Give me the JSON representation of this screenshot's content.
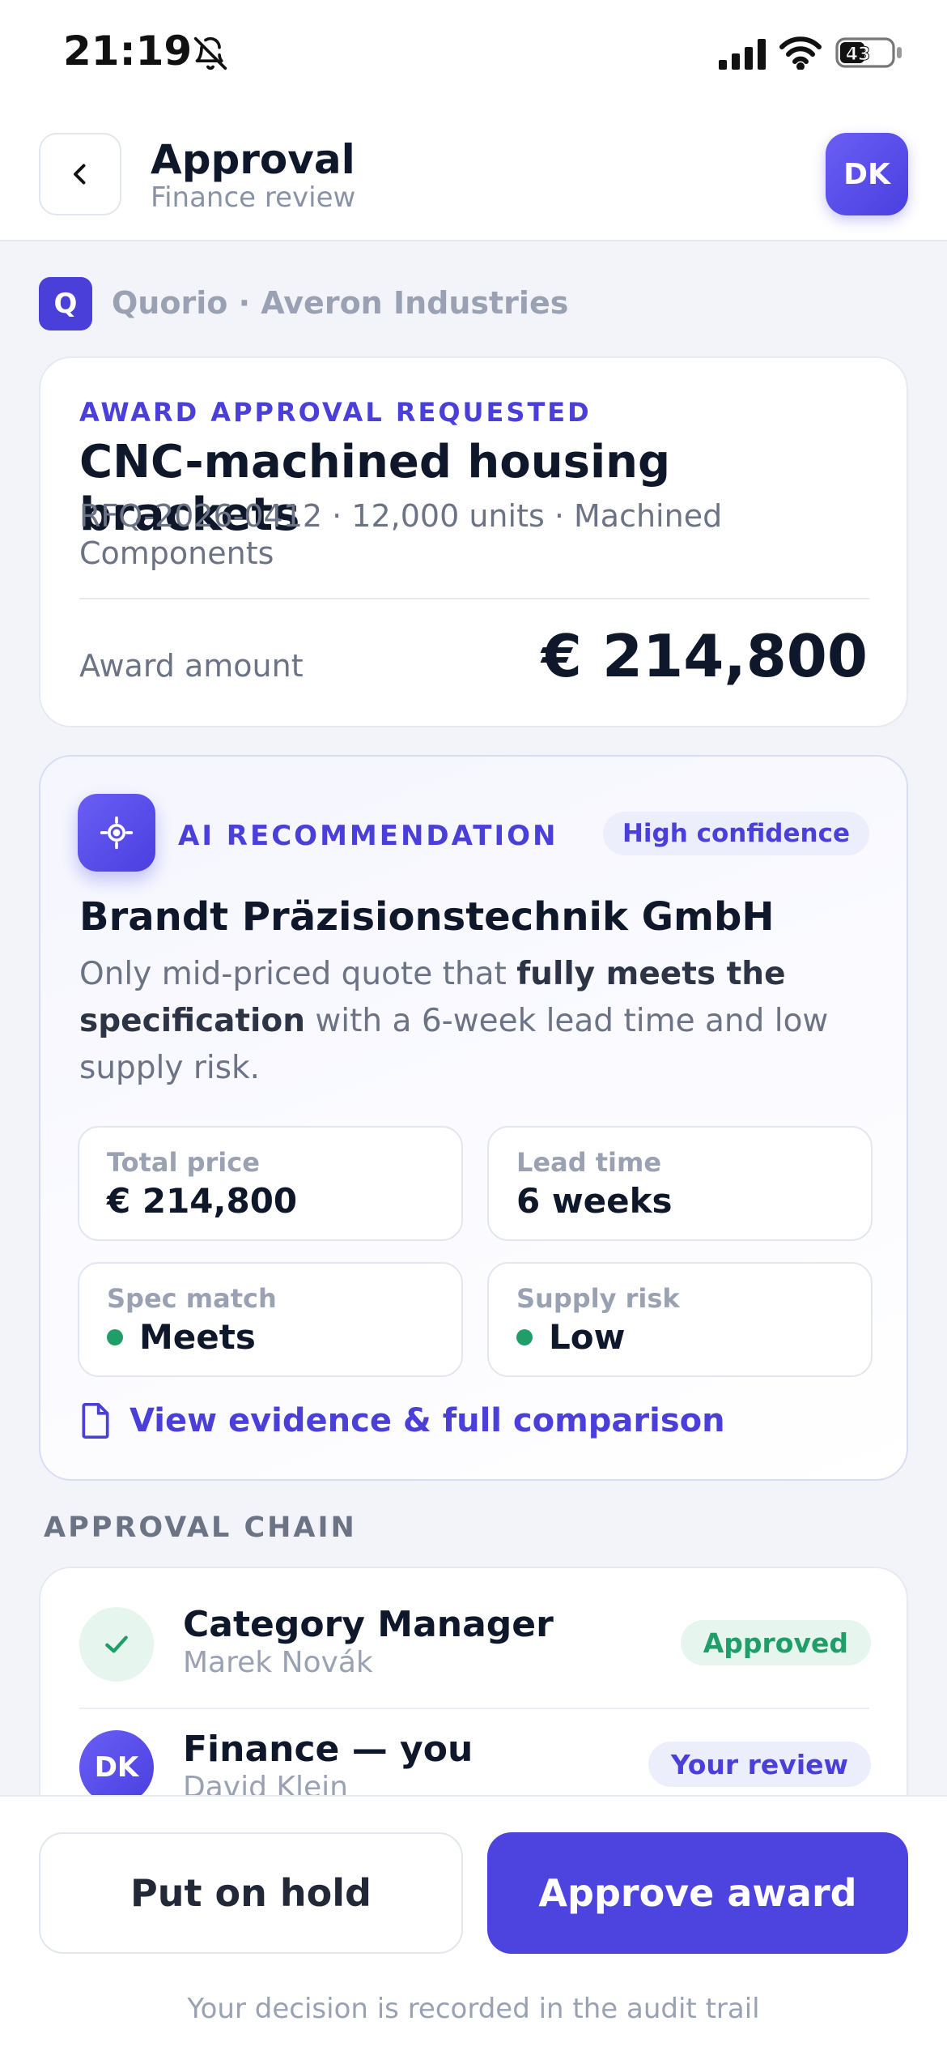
{
  "status_bar": {
    "time": "21:19",
    "battery_level": "43",
    "icons": [
      "bell-slash-icon",
      "signal-icon",
      "wifi-icon",
      "battery-icon"
    ]
  },
  "header": {
    "title": "Approval",
    "subtitle": "Finance review",
    "avatar_initials": "DK"
  },
  "brand": {
    "logo_letter": "Q",
    "text": "Quorio · Averon Industries"
  },
  "award": {
    "eyebrow": "AWARD APPROVAL REQUESTED",
    "title": "CNC-machined housing brackets",
    "meta": "RFQ-2026-0412 · 12,000 units · Machined Components",
    "amount_label": "Award amount",
    "amount": "€ 214,800"
  },
  "ai": {
    "eyebrow": "AI RECOMMENDATION",
    "confidence": "High confidence",
    "supplier": "Brandt Präzisionstechnik GmbH",
    "reason_start": "Only mid-priced quote that ",
    "reason_bold": "fully meets the specification",
    "reason_end": " with a 6-week lead time and low supply risk.",
    "metrics": [
      {
        "label": "Total price",
        "value": "€ 214,800"
      },
      {
        "label": "Lead time",
        "value": "6 weeks"
      },
      {
        "label": "Spec match",
        "value": "Meets"
      },
      {
        "label": "Supply risk",
        "value": "Low"
      }
    ],
    "evidence_link": "View evidence & full comparison"
  },
  "chain": {
    "title": "APPROVAL CHAIN",
    "steps": [
      {
        "role": "Category Manager",
        "name": "Marek Novák",
        "status": "Approved"
      },
      {
        "role": "Finance — you",
        "name": "David Klein",
        "initials": "DK",
        "status": "Your review"
      }
    ]
  },
  "actions": {
    "hold": "Put on hold",
    "approve": "Approve award",
    "note": "Your decision is recorded in the audit trail"
  },
  "colors": {
    "accent": "#4d44e0",
    "success": "#1f9e6a",
    "background": "#f2f4f9"
  }
}
